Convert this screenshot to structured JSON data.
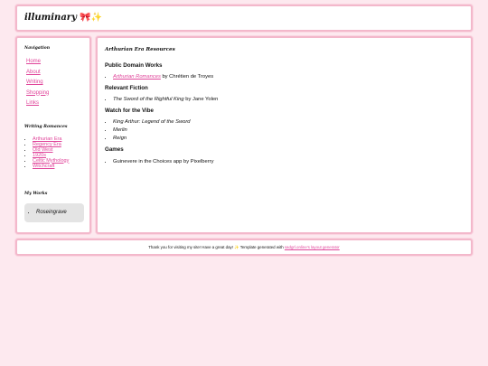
{
  "header": {
    "title": "illuminary",
    "bow": "🎀",
    "sparkles": "✨"
  },
  "sidebar": {
    "nav_heading": "Navigation",
    "nav_items": [
      "Home",
      "About",
      "Writing",
      "Shopping",
      "Links"
    ],
    "romance_heading": "Writing Romances",
    "romance_items": [
      "Arthurian Era",
      "Regency Era",
      "Old West",
      "1920s",
      "Celtic Mythology",
      "Witchcraft"
    ],
    "works_heading": "My Works",
    "works_items": [
      "Roseingrave"
    ]
  },
  "main": {
    "title": "Arthurian Era Resources",
    "pd_heading": "Public Domain Works",
    "pd_link": "Arthurian Romances",
    "pd_rest": " by Chrétien de Troyes",
    "rf_heading": "Relevant Fiction",
    "rf_title": "The Sword of the Rightful King",
    "rf_rest": " by Jane Yolen",
    "vibe_heading": "Watch for the Vibe",
    "vibe_items": [
      "King Arthur: Legend of the Sword",
      "Merlin",
      "Reign"
    ],
    "games_heading": "Games",
    "games_item": "Guinevere in the Choices app by Pixelberry"
  },
  "footer": {
    "text_before": "Thank you for visiting my site! Have a great day! ",
    "sparkle": "✨",
    "text_middle": " Template generated with ",
    "link": "sadgrl.online's layout generator"
  }
}
